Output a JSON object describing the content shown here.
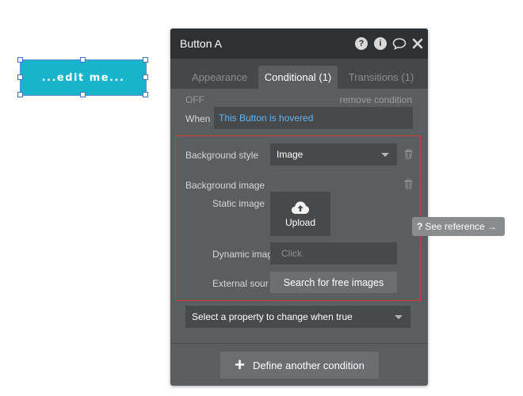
{
  "canvas_button": {
    "label": "...edit me..."
  },
  "panel": {
    "title": "Button A",
    "header_icons": [
      "help-icon",
      "info-icon",
      "comment-icon",
      "close-icon"
    ],
    "tabs": [
      {
        "label": "Appearance",
        "active": false
      },
      {
        "label": "Conditional (1)",
        "active": true
      },
      {
        "label": "Transitions (1)",
        "active": false
      }
    ],
    "status": "OFF",
    "remove_condition": "remove condition",
    "when_label": "When",
    "when_value": "This Button is hovered",
    "background_style_label": "Background style",
    "background_style_value": "Image",
    "background_image_label": "Background image",
    "static_image_label": "Static image",
    "upload_label": "Upload",
    "dynamic_image_label": "Dynamic imag",
    "dynamic_image_placeholder": "Click",
    "external_source_label": "External sour",
    "search_free_images": "Search for free images",
    "select_property": "Select a property to change when true",
    "define_condition": "Define another condition"
  },
  "see_reference": "See reference →",
  "colors": {
    "accent_teal": "#17b4cc",
    "panel_header": "#2e3134",
    "panel_body": "#5b5e60",
    "highlight_border": "#d9383a",
    "link_blue": "#63b4f0"
  }
}
